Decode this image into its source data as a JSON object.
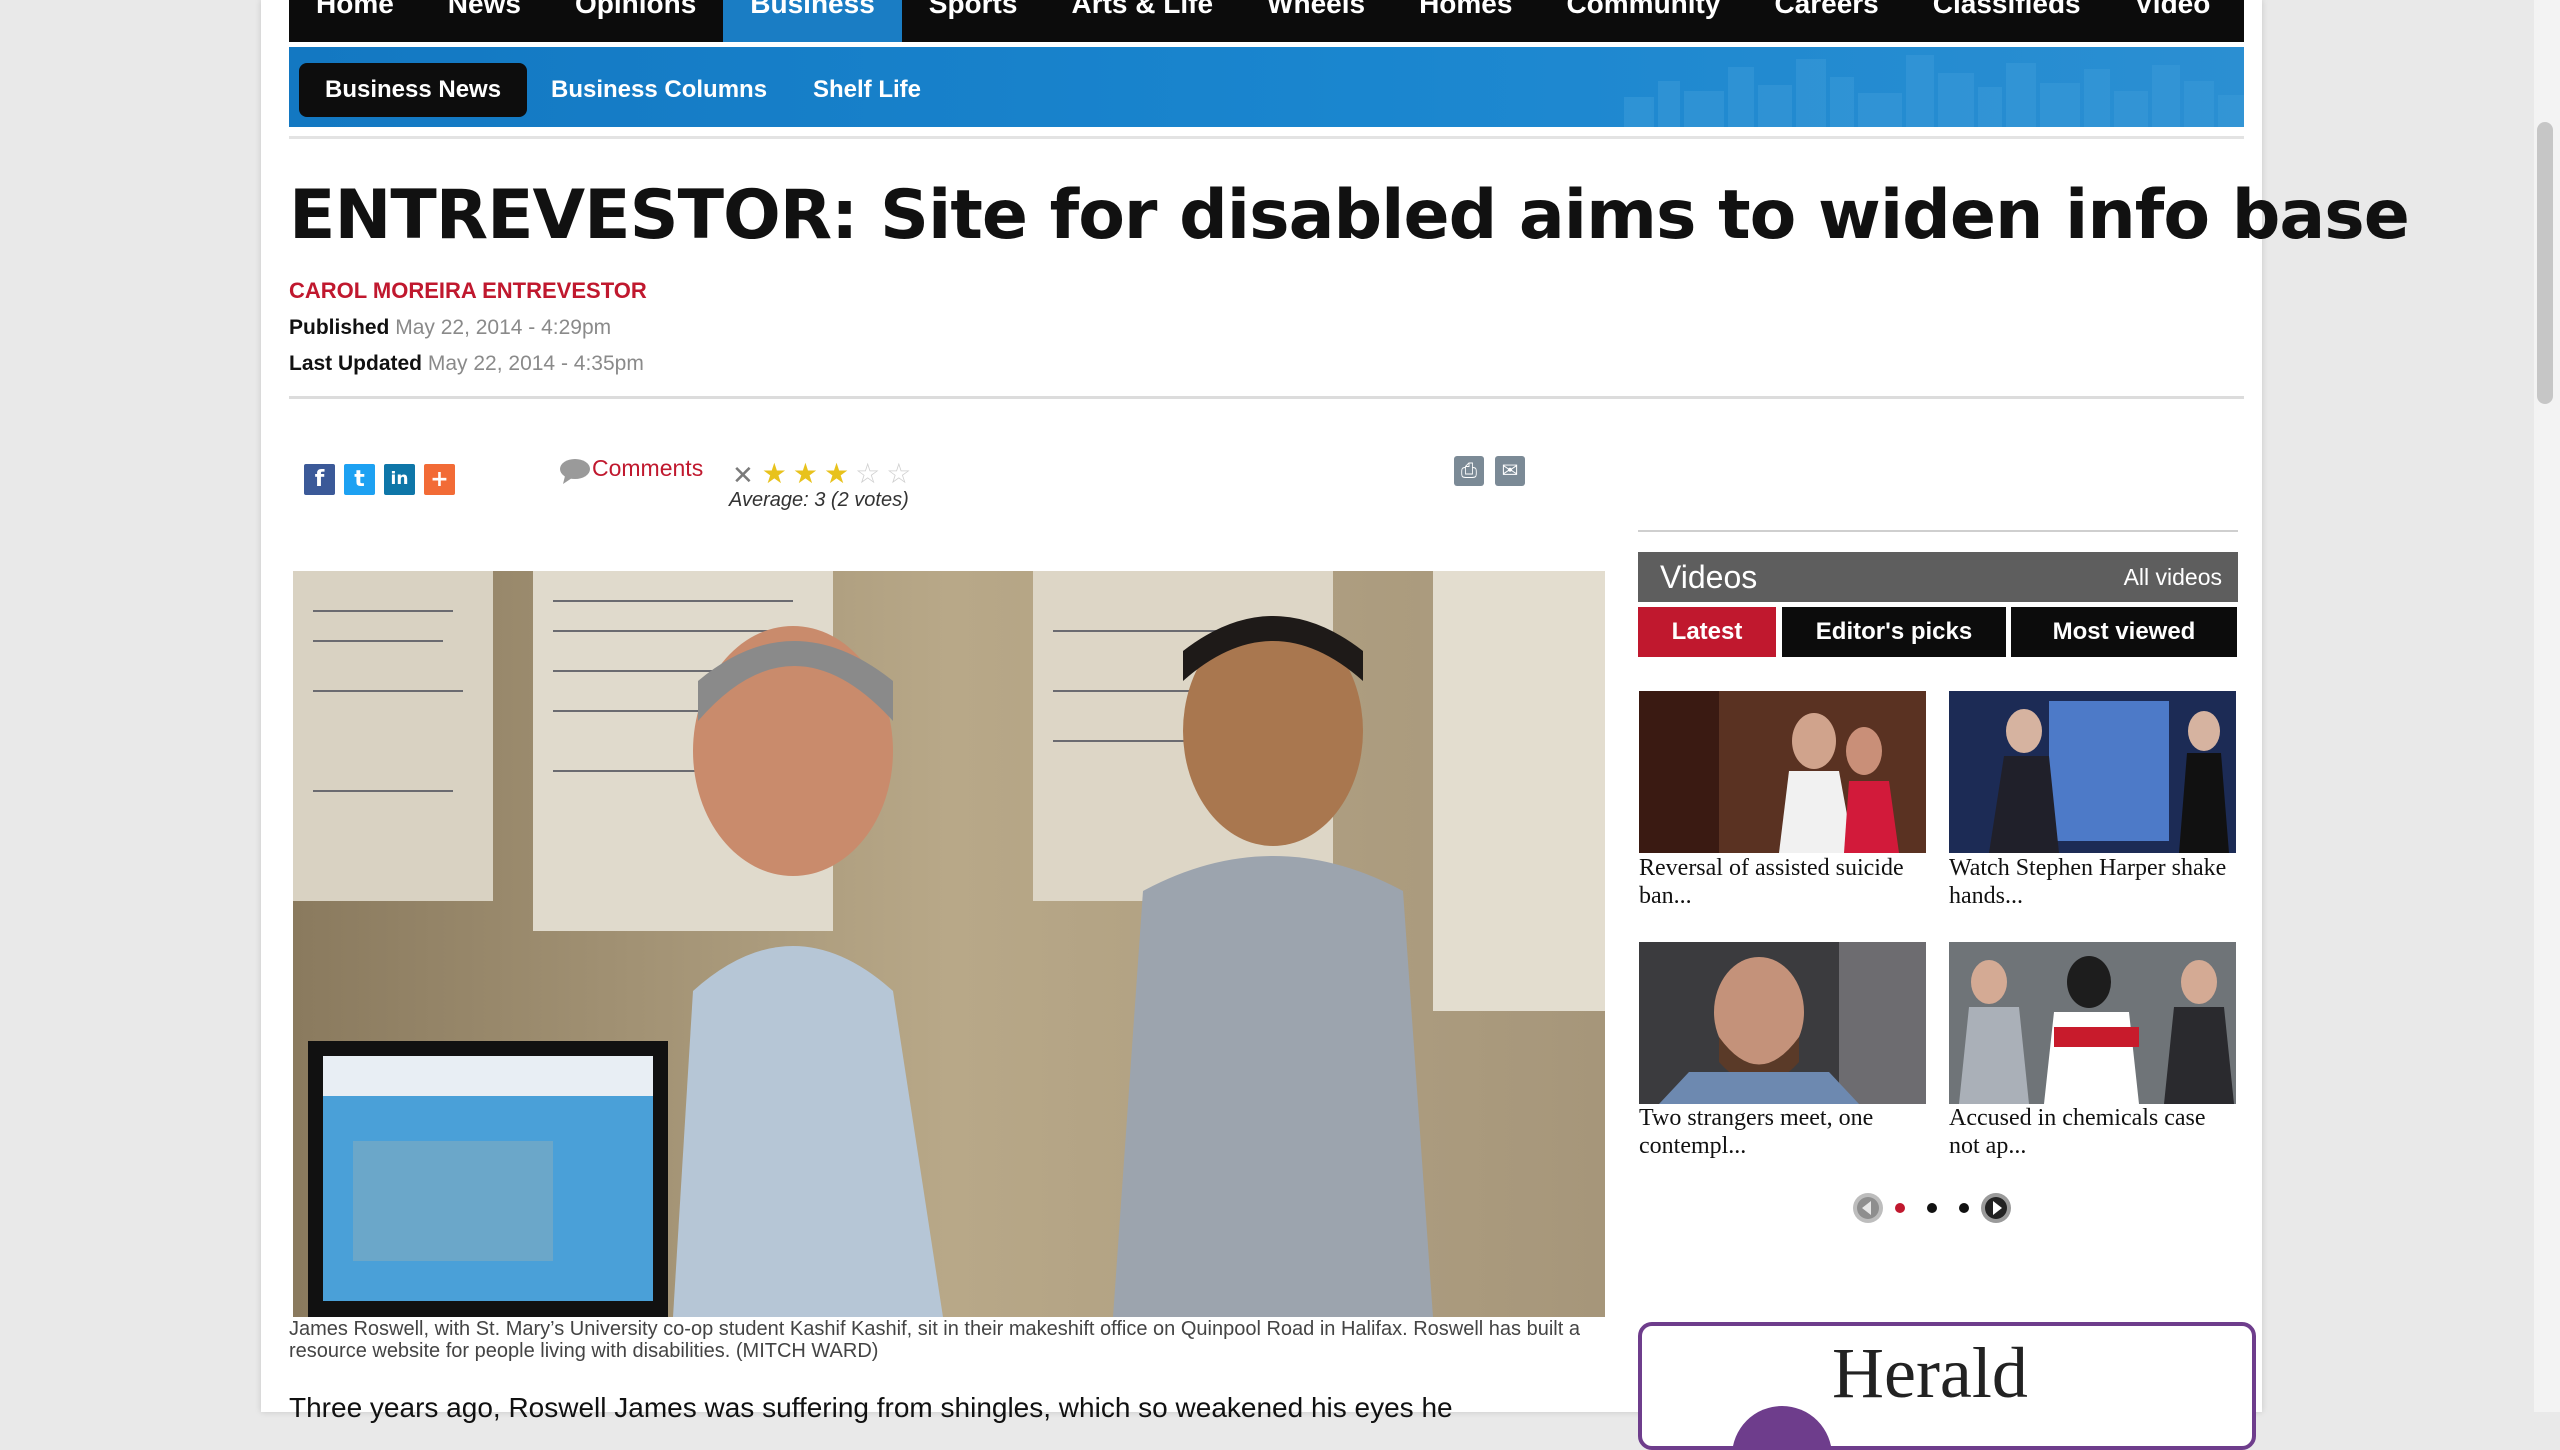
{
  "main_nav": {
    "items": [
      "Home",
      "News",
      "Opinions",
      "Business",
      "Sports",
      "Arts & Life",
      "Wheels",
      "Homes",
      "Community",
      "Careers",
      "Classifieds",
      "Video"
    ],
    "active": "Business"
  },
  "sub_nav": {
    "items": [
      "Business News",
      "Business Columns",
      "Shelf Life"
    ],
    "active": "Business News"
  },
  "article": {
    "title": "ENTREVESTOR: Site for disabled aims to widen info base",
    "author": "CAROL MOREIRA ENTREVESTOR",
    "published_label": "Published",
    "published_value": "May 22, 2014 - 4:29pm",
    "updated_label": "Last Updated",
    "updated_value": "May 22, 2014 - 4:35pm",
    "comments_label": "Comments",
    "rating_average": "Average: 3 (2 votes)",
    "rating_value": 3,
    "rating_max": 5,
    "photo_caption": "James Roswell, with St. Mary’s University co-op student Kashif Kashif, sit in their makeshift office on Quinpool Road in Halifax. Roswell has built a resource website for people living with disabilities. (MITCH WARD)",
    "body_start": "Three years ago, Roswell James was suffering from shingles, which so weakened his eyes he"
  },
  "share": {
    "facebook": "f",
    "twitter": "t",
    "linkedin": "in",
    "more": "+"
  },
  "videos": {
    "title": "Videos",
    "all_label": "All videos",
    "tabs": [
      "Latest",
      "Editor's picks",
      "Most viewed"
    ],
    "active_tab": "Latest",
    "items": [
      {
        "caption": "Reversal of assisted suicide ban..."
      },
      {
        "caption": "Watch Stephen Harper shake hands..."
      },
      {
        "caption": "Two strangers meet, one contempl..."
      },
      {
        "caption": "Accused in chemicals case not ap..."
      }
    ],
    "pager_pages": 3,
    "pager_active": 1
  },
  "ad": {
    "text": "Herald"
  },
  "colors": {
    "accent_red": "#c0182e",
    "nav_blue": "#1a7dc4",
    "nav_black": "#0c0c0c",
    "video_header": "#5e5e5e"
  }
}
